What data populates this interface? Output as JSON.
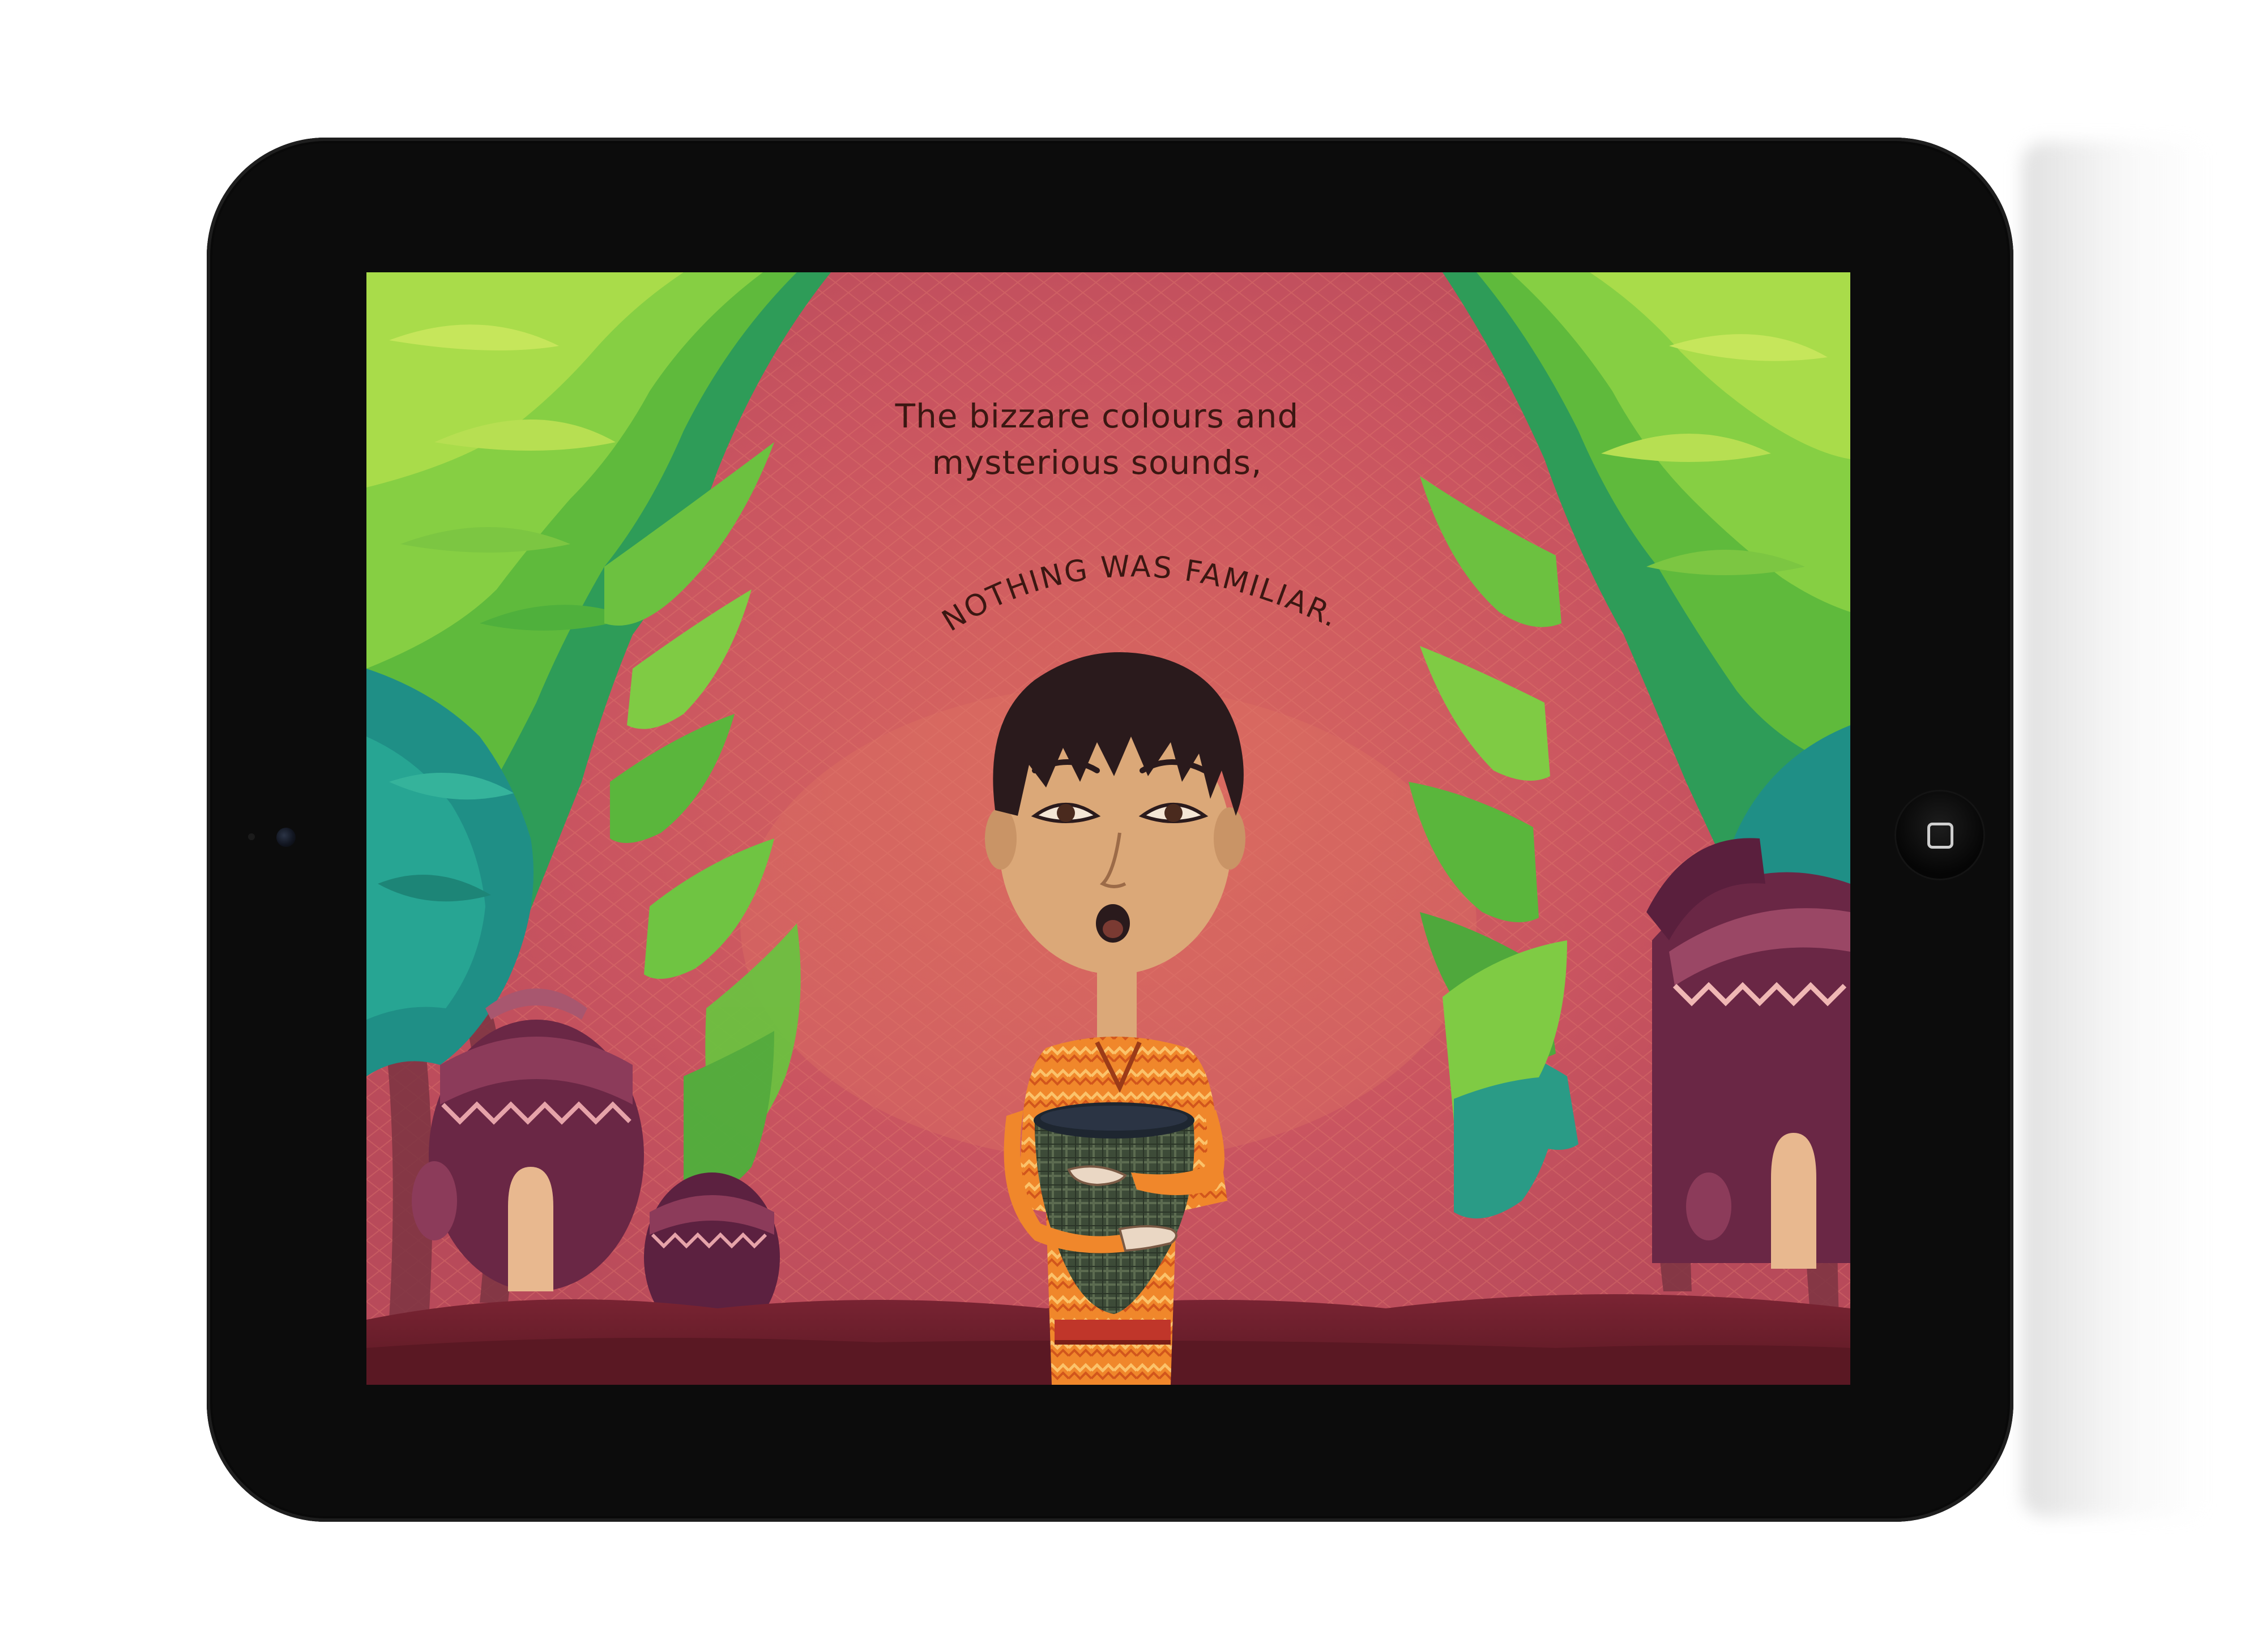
{
  "story": {
    "line1": "The bizzare colours and",
    "line2": "mysterious sounds,",
    "banner": "NOTHING WAS FAMILIAR."
  },
  "colors": {
    "background_red": "#c8565b",
    "leaf_green": "#5bb83a",
    "leaf_teal": "#1f9a8a",
    "ground": "#6e1f2a",
    "hut_purple": "#6a2745",
    "robe_orange": "#f08a2a",
    "text_dark": "#3b1712"
  },
  "icons": {
    "home_button": "home-square-icon",
    "camera": "front-camera-icon"
  }
}
